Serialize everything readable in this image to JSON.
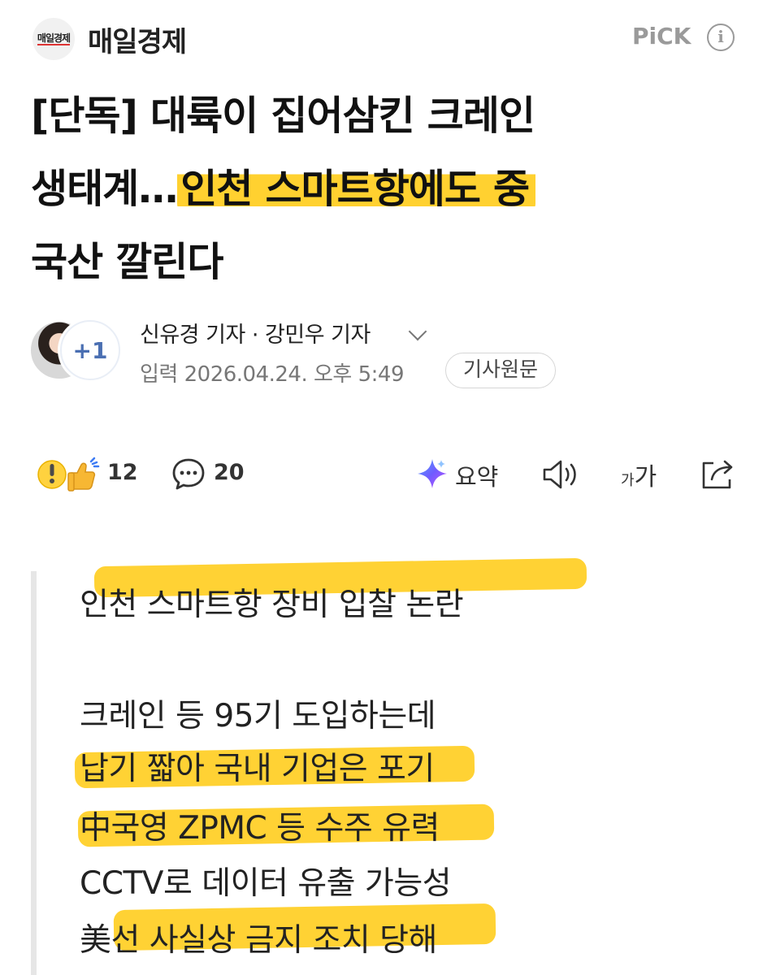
{
  "header": {
    "logo_text": "매일경제",
    "press_name": "매일경제",
    "pick_label": "PiCK",
    "info_glyph": "i"
  },
  "headline": {
    "line1": "[단독] 대륙이 집어삼킨 크레인",
    "line2_plain": "생태계…",
    "line2_highlight": "인천 스마트항에도 중",
    "line3": "국산 깔린다"
  },
  "author": {
    "extra_count": "+1",
    "names": "신유경 기자 · 강민우 기자",
    "date": "입력 2026.04.24. 오후 5:49",
    "original_button": "기사원문"
  },
  "toolbar": {
    "reaction_count": "12",
    "comment_count": "20",
    "summary_label": "요약",
    "font_small": "가",
    "font_large": "가"
  },
  "body": {
    "lines": [
      "인천 스마트항 장비 입찰 논란",
      "크레인 등 95기 도입하는데",
      "납기 짧아 국내 기업은 포기",
      "中국영 ZPMC 등 수주 유력",
      "CCTV로 데이터 유출 가능성",
      "美선 사실상 금지 조치 당해"
    ]
  },
  "colors": {
    "highlight": "#FFCD1E",
    "pick_gray": "#9A9A9A",
    "avatar_blue": "#4A6FB2"
  }
}
